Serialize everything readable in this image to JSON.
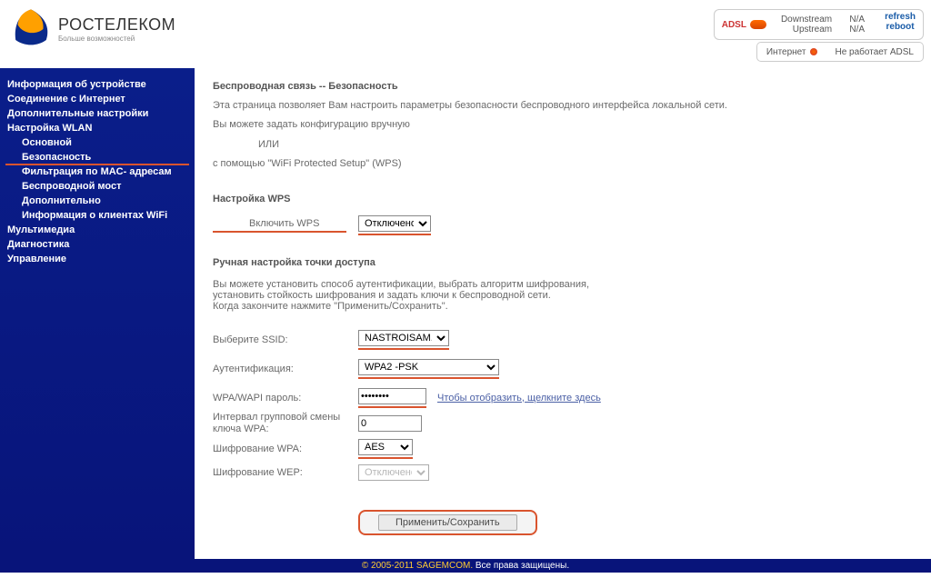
{
  "brand": {
    "main": "РОСТЕЛЕКОМ",
    "sub": "Больше возможностей"
  },
  "status": {
    "adsl_label": "ADSL",
    "downstream_label": "Downstream",
    "upstream_label": "Upstream",
    "down_val": "N/A",
    "up_val": "N/A",
    "refresh": "refresh",
    "reboot": "reboot",
    "internet_label": "Интернет",
    "internet_status": "Не работает ADSL"
  },
  "nav": {
    "device": "Информация об устройстве",
    "conn": "Соединение с Интернет",
    "adv": "Дополнительные настройки",
    "wlan": "Настройка WLAN",
    "wlan_sub": {
      "basic": "Основной",
      "security": "Безопасность",
      "mac": "Фильтрация по MAC- адресам",
      "bridge": "Беспроводной мост",
      "extra": "Дополнительно",
      "clients": "Информация о клиентах WiFi"
    },
    "media": "Мультимедиа",
    "diag": "Диагностика",
    "manage": "Управление"
  },
  "page": {
    "title": "Беспроводная связь -- Безопасность",
    "intro1": "Эта страница позволяет Вам настроить параметры безопасности беспроводного интерфейса локальной сети.",
    "intro2": "Вы можете задать конфигурацию вручную",
    "intro3": "ИЛИ",
    "intro4": "с помощью \"WiFi Protected Setup\" (WPS)",
    "wps_heading": "Настройка WPS",
    "wps_enable_label": "Включить WPS",
    "wps_value": "Отключено",
    "manual_heading": "Ручная настройка точки доступа",
    "manual_p1": "Вы можете установить способ аутентификации, выбрать алгоритм шифрования,",
    "manual_p2": "установить стойкость шифрования и задать ключи к беспроводной сети.",
    "manual_p3": "Когда закончите нажмите \"Применить/Сохранить\".",
    "ssid_label": "Выберите SSID:",
    "ssid_value": "NASTROISAM.RU",
    "auth_label": "Аутентификация:",
    "auth_value": "WPA2 -PSK",
    "pass_label": "WPA/WAPI пароль:",
    "pass_value": "••••••••",
    "pass_hint": "Чтобы отобразить, щелкните здесь",
    "rekey_label": "Интервал групповой смены ключа WPA:",
    "rekey_value": "0",
    "wpa_enc_label": "Шифрование WPA:",
    "wpa_enc_value": "AES",
    "wep_enc_label": "Шифрование WEP:",
    "wep_enc_value": "Отключено",
    "submit": "Применить/Сохранить"
  },
  "footer": {
    "copy": "© 2005-2011 SAGEMCOM.",
    "rights": "Все права защищены."
  }
}
